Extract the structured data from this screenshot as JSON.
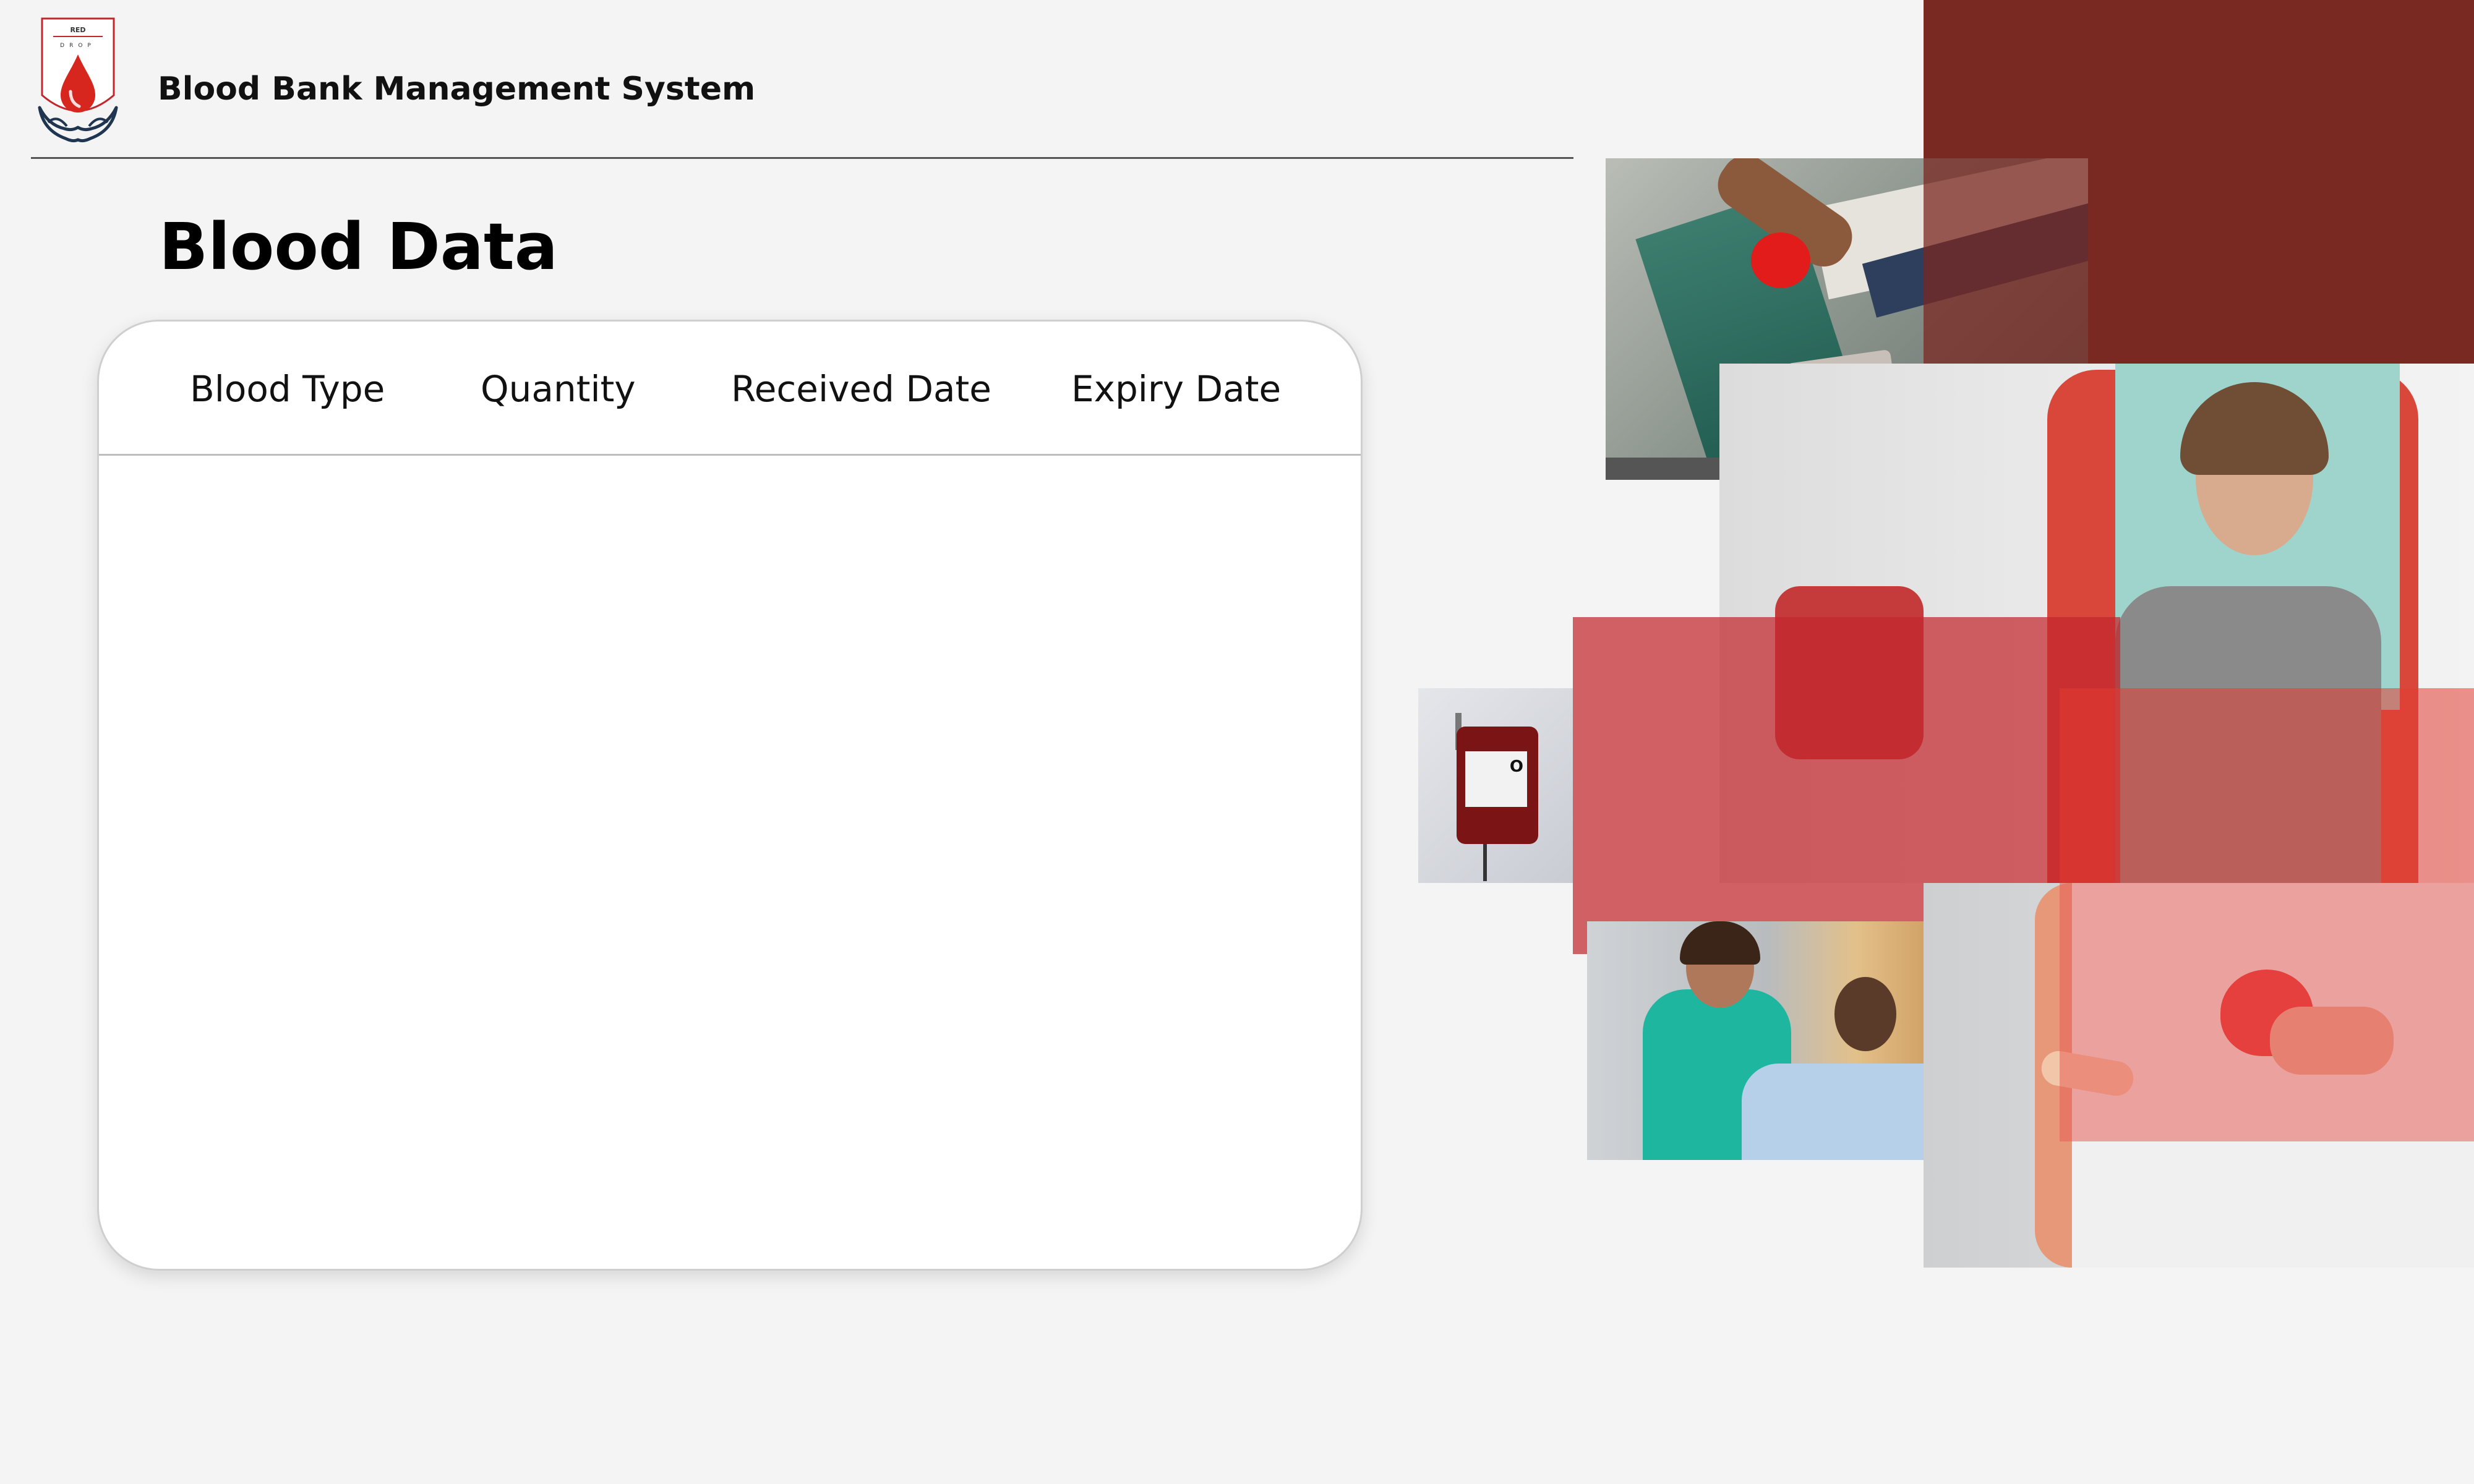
{
  "header": {
    "app_title": "Blood Bank Management System",
    "logo_text_top": "RED",
    "logo_text_bottom": "DROP"
  },
  "page": {
    "title": "Blood Data"
  },
  "table": {
    "columns": [
      "Blood Type",
      "Quantity",
      "Received Date",
      "Expiry Date"
    ],
    "rows": []
  },
  "bag_label": "O",
  "colors": {
    "background": "#f4f4f4",
    "brand_red": "#7a2822",
    "overlay_red": "#c2272d",
    "drop_red": "#d7261e",
    "hands_navy": "#1f3550"
  },
  "icons": [
    "blood-drop-icon",
    "hands-icon",
    "heart-icon",
    "blood-bag-icon"
  ]
}
